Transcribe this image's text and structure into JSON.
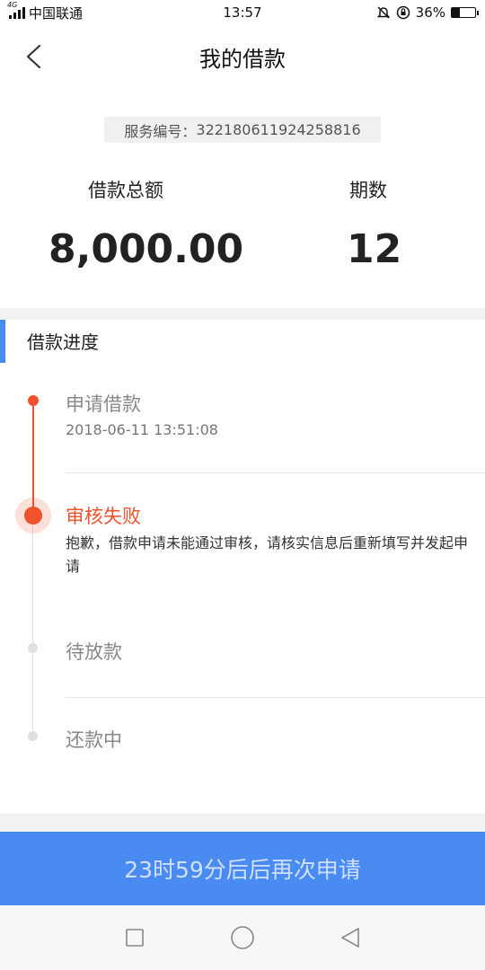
{
  "status_bar": {
    "network_type": "4G",
    "carrier": "中国联通",
    "time": "13:57",
    "battery_percent": "36%",
    "battery_level": 0.36
  },
  "header": {
    "title": "我的借款"
  },
  "summary": {
    "service_number_label": "服务编号：",
    "service_number": "322180611924258816",
    "total_label": "借款总额",
    "total_value": "8,000.00",
    "periods_label": "期数",
    "periods_value": "12"
  },
  "progress": {
    "section_title": "借款进度",
    "steps": [
      {
        "title": "申请借款",
        "time": "2018-06-11 13:51:08",
        "state": "done"
      },
      {
        "title": "审核失败",
        "description": "抱歉，借款申请未能通过审核，请核实信息后重新填写并发起申请",
        "state": "failed"
      },
      {
        "title": "待放款",
        "state": "pending"
      },
      {
        "title": "还款中",
        "state": "pending"
      }
    ]
  },
  "action": {
    "label": "23时59分后后再次申请"
  },
  "colors": {
    "accent_blue": "#4a8bf2",
    "alert_red": "#f0522d",
    "muted_grey": "#e0e0e0"
  },
  "icons": {
    "back": "chevron-left-icon",
    "nav_recent": "square-icon",
    "nav_home": "circle-icon",
    "nav_back": "triangle-left-icon"
  }
}
